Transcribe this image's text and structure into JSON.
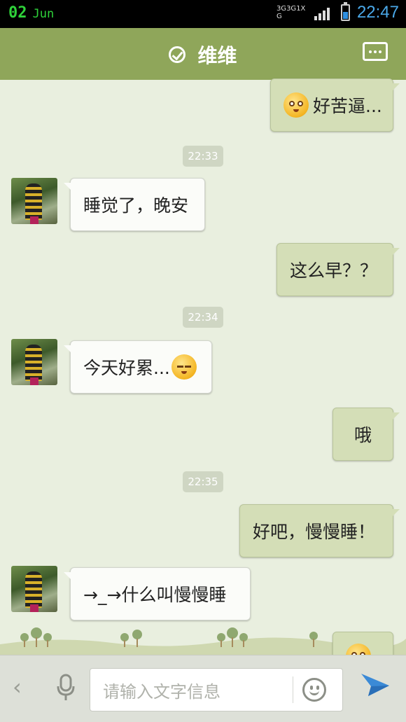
{
  "status_bar": {
    "day": "02",
    "month": "Jun",
    "network": [
      "3G",
      "3G",
      "1X",
      "G"
    ],
    "time": "22:47"
  },
  "header": {
    "title": "维维",
    "verified_icon": "check-circle-icon",
    "menu_icon": "more-icon"
  },
  "messages": [
    {
      "type": "out",
      "emoji": "pleading-emoji",
      "text": "好苦逼..."
    },
    {
      "type": "time",
      "text": "22:33"
    },
    {
      "type": "in",
      "text": "睡觉了，晚安"
    },
    {
      "type": "out",
      "text": "这么早？？"
    },
    {
      "type": "time",
      "text": "22:34"
    },
    {
      "type": "in",
      "text": "今天好累...",
      "emoji": "sleepy-emoji"
    },
    {
      "type": "out",
      "text": "哦"
    },
    {
      "type": "time",
      "text": "22:35"
    },
    {
      "type": "out",
      "text": "好吧，慢慢睡！"
    },
    {
      "type": "in",
      "text": "→_→什么叫慢慢睡"
    },
    {
      "type": "out",
      "emoji": "pleading-emoji",
      "text": ""
    }
  ],
  "input": {
    "placeholder": "请输入文字信息"
  },
  "colors": {
    "header_bg": "#8fa65a",
    "chat_bg": "#e9efdf",
    "outgoing_bubble": "#d4deb7",
    "incoming_bubble": "#fbfcf9",
    "status_date": "#2fd23a",
    "status_time": "#4aa8e8",
    "send_icon": "#3b8ad6"
  }
}
